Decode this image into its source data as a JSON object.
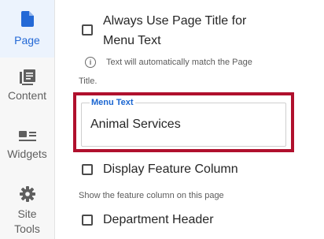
{
  "sidebar": {
    "items": [
      {
        "label": "Page",
        "icon": "page-icon",
        "active": true
      },
      {
        "label": "Content",
        "icon": "content-icon",
        "active": false
      },
      {
        "label": "Widgets",
        "icon": "widgets-icon",
        "active": false
      },
      {
        "label_line1": "Site",
        "label_line2": "Tools",
        "icon": "gear-icon",
        "active": false
      }
    ]
  },
  "page_settings": {
    "always_use_title": {
      "line1": "Always Use Page Title for",
      "line2": "Menu Text",
      "checked": false
    },
    "always_use_title_help": {
      "line1": "Text will automatically match the Page",
      "line2": "Title."
    },
    "menu_text": {
      "legend": "Menu Text",
      "value": "Animal Services"
    },
    "display_feature_column": {
      "label": "Display Feature Column",
      "checked": false
    },
    "display_feature_column_help": "Show the feature column on this page",
    "department_header": {
      "label": "Department Header",
      "checked": false
    }
  },
  "colors": {
    "accent": "#2469d6",
    "highlight": "#b0102d"
  }
}
